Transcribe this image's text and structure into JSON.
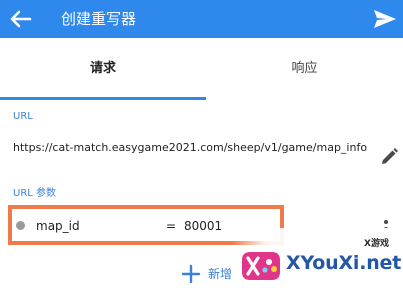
{
  "appbar": {
    "title": "创建重写器",
    "back_icon": "arrow-left-icon",
    "send_icon": "send-icon"
  },
  "tabs": [
    {
      "label": "请求",
      "selected": true
    },
    {
      "label": "响应",
      "selected": false
    }
  ],
  "url_section": {
    "label": "URL",
    "value": "https://cat-match.easygame2021.com/sheep/v1/game/map_info",
    "edit_icon": "pencil-icon"
  },
  "params_section": {
    "label": "URL 参数",
    "params": [
      {
        "key": "map_id",
        "separator": "=",
        "value": "80001"
      }
    ],
    "more_icon": "more-vertical-icon",
    "add_label": "新增",
    "add_icon": "plus-icon"
  },
  "watermark": {
    "brand": "XYouXi.net",
    "tagline": "X游戏"
  },
  "colors": {
    "accent": "#2f88ec",
    "highlight_border": "#f07a4a",
    "section_label": "#3b82d6"
  }
}
